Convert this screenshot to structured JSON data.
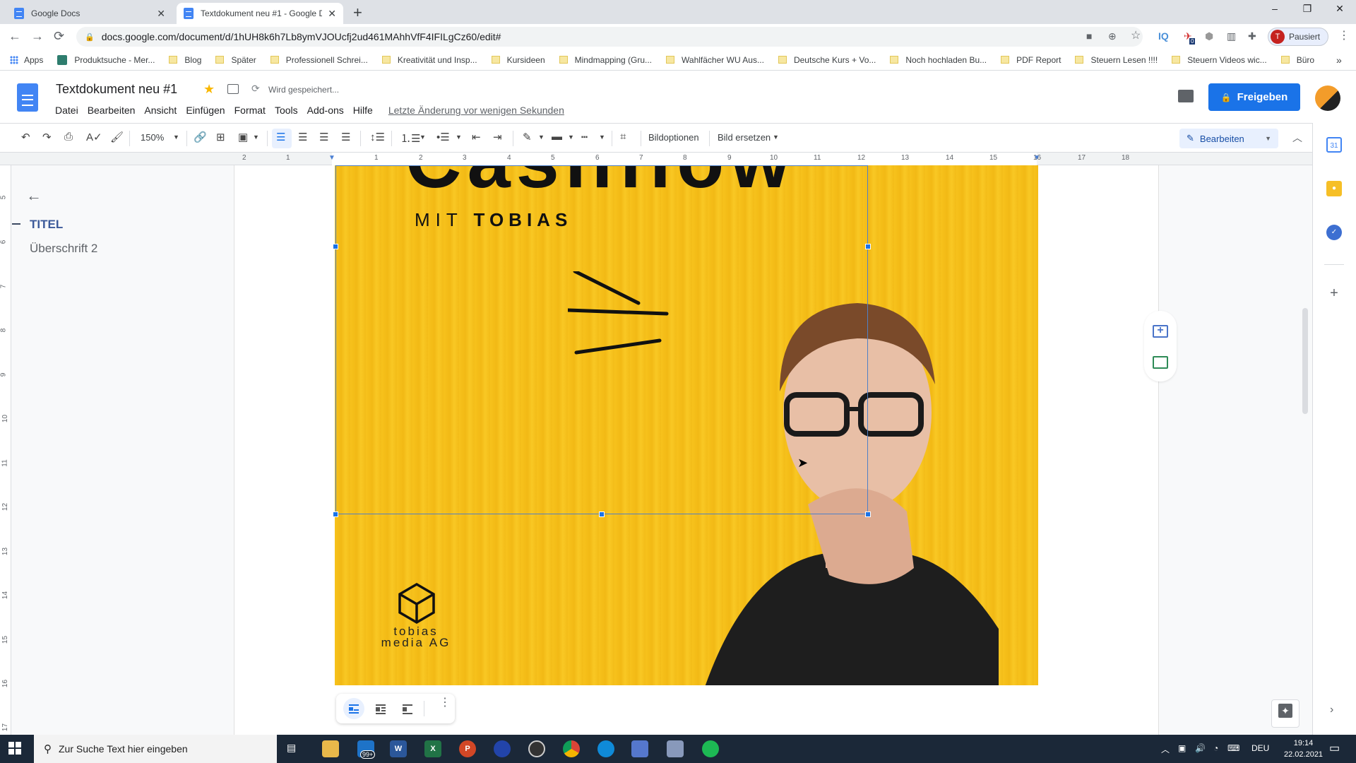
{
  "browser": {
    "tabs": [
      {
        "title": "Google Docs",
        "active": false
      },
      {
        "title": "Textdokument neu #1 - Google D",
        "active": true
      }
    ],
    "new_tab_label": "+",
    "window_controls": {
      "minimize": "–",
      "restore": "❐",
      "close": "✕"
    },
    "url": "docs.google.com/document/d/1hUH8k6h7Lb8ymVJOUcfj2ud461MAhhVfF4IFILgCz60/edit#",
    "nav": {
      "back": "←",
      "forward": "→",
      "reload": "⟳"
    },
    "extensions": [
      "camera-icon",
      "zoom-icon",
      "star-icon",
      "iq-icon",
      "bird-extension-icon",
      "abp-icon",
      "stats-icon",
      "puzzle-icon"
    ],
    "extension_badge": "0",
    "profile": {
      "initial": "T",
      "label": "Pausiert"
    },
    "bookmarks": [
      {
        "label": "Apps",
        "type": "apps"
      },
      {
        "label": "Produktsuche - Mer...",
        "type": "site"
      },
      {
        "label": "Blog",
        "type": "folder"
      },
      {
        "label": "Später",
        "type": "folder"
      },
      {
        "label": "Professionell Schrei...",
        "type": "folder"
      },
      {
        "label": "Kreativität und Insp...",
        "type": "folder"
      },
      {
        "label": "Kursideen",
        "type": "folder"
      },
      {
        "label": "Mindmapping (Gru...",
        "type": "folder"
      },
      {
        "label": "Wahlfächer WU Aus...",
        "type": "folder"
      },
      {
        "label": "Deutsche Kurs + Vo...",
        "type": "folder"
      },
      {
        "label": "Noch hochladen Bu...",
        "type": "folder"
      },
      {
        "label": "PDF Report",
        "type": "folder"
      },
      {
        "label": "Steuern Lesen !!!!",
        "type": "folder"
      },
      {
        "label": "Steuern Videos wic...",
        "type": "folder"
      },
      {
        "label": "Büro",
        "type": "folder"
      }
    ],
    "bookmarks_overflow": "»"
  },
  "docs": {
    "title": "Textdokument neu #1",
    "save_status": "Wird gespeichert...",
    "menu": [
      "Datei",
      "Bearbeiten",
      "Ansicht",
      "Einfügen",
      "Format",
      "Tools",
      "Add-ons",
      "Hilfe"
    ],
    "last_edit": "Letzte Änderung vor wenigen Sekunden",
    "share_label": "Freigeben",
    "accent_color": "#1a73e8"
  },
  "toolbar": {
    "zoom": "150%",
    "image_options": "Bildoptionen",
    "replace_image": "Bild ersetzen",
    "mode": "Bearbeiten"
  },
  "ruler": {
    "horizontal": [
      "2",
      "1",
      "1",
      "2",
      "3",
      "4",
      "5",
      "6",
      "7",
      "8",
      "9",
      "10",
      "11",
      "12",
      "13",
      "14",
      "15",
      "16",
      "17",
      "18"
    ],
    "vertical": [
      "5",
      "6",
      "7",
      "8",
      "9",
      "10",
      "11",
      "12",
      "13",
      "14",
      "15",
      "16",
      "17"
    ]
  },
  "outline": {
    "items": [
      {
        "label": "TITEL",
        "level": "title",
        "active": true
      },
      {
        "label": "Überschrift 2",
        "level": "h2",
        "active": false
      }
    ]
  },
  "image": {
    "big_text_partial": "Cashflow",
    "subtitle_light": "MIT",
    "subtitle_bold": "TOBIAS",
    "logo_line1": "tobias",
    "logo_line2": "media AG"
  },
  "taskbar": {
    "search_placeholder": "Zur Suche Text hier eingeben",
    "mail_badge": "99+",
    "language": "DEU",
    "time": "19:14",
    "date": "22.02.2021"
  }
}
